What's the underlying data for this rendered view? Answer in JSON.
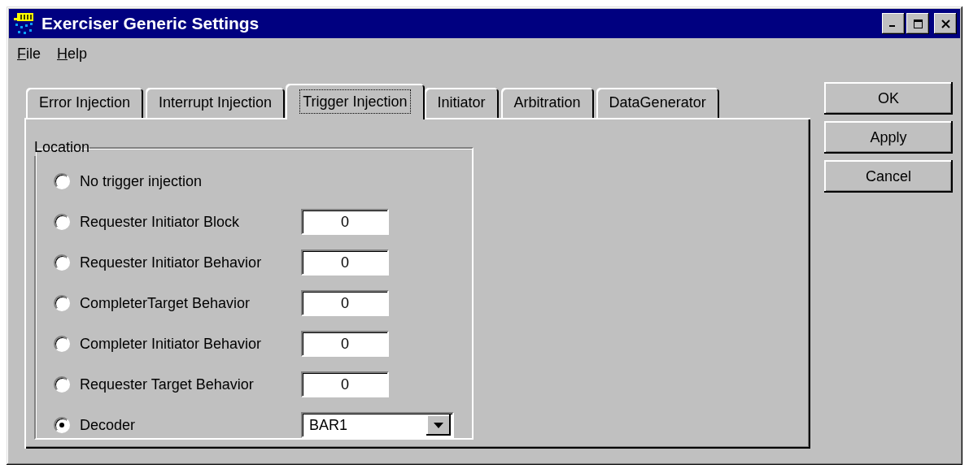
{
  "window": {
    "title": "Exerciser Generic Settings"
  },
  "menu": [
    {
      "label": "File"
    },
    {
      "label": "Help"
    }
  ],
  "tabs": [
    {
      "label": "Error Injection",
      "selected": false
    },
    {
      "label": "Interrupt Injection",
      "selected": false
    },
    {
      "label": "Trigger Injection",
      "selected": true
    },
    {
      "label": "Initiator",
      "selected": false
    },
    {
      "label": "Arbitration",
      "selected": false
    },
    {
      "label": "DataGenerator",
      "selected": false
    }
  ],
  "group": {
    "label": "Location",
    "options": [
      {
        "label": "No trigger injection",
        "selected": false,
        "kind": "plain"
      },
      {
        "label": "Requester Initiator Block",
        "selected": false,
        "kind": "field",
        "value": "0"
      },
      {
        "label": "Requester Initiator Behavior",
        "selected": false,
        "kind": "field",
        "value": "0"
      },
      {
        "label": "CompleterTarget Behavior",
        "selected": false,
        "kind": "field",
        "value": "0"
      },
      {
        "label": "Completer Initiator Behavior",
        "selected": false,
        "kind": "field",
        "value": "0"
      },
      {
        "label": "Requester Target Behavior",
        "selected": false,
        "kind": "field",
        "value": "0"
      },
      {
        "label": "Decoder",
        "selected": true,
        "kind": "dropdown",
        "value": "BAR1"
      }
    ]
  },
  "buttons": [
    {
      "label": "OK"
    },
    {
      "label": "Apply"
    },
    {
      "label": "Cancel"
    }
  ]
}
